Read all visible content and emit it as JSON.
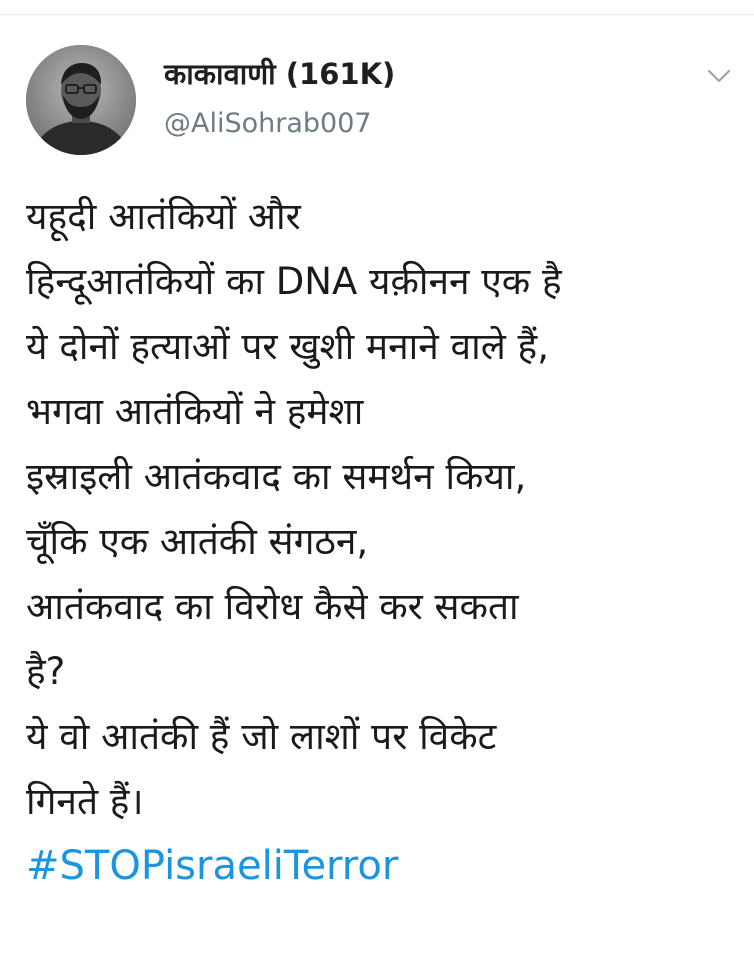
{
  "tweet": {
    "display_name": "काकावाणी (161K)",
    "handle": "@AliSohrab007",
    "avatar_icon": "profile-photo",
    "menu_icon": "chevron-down-icon",
    "lines": [
      "यहूदी आतंकियों और",
      "हिन्दूआतंकियों का DNA यक़ीनन एक है",
      "ये दोनों हत्याओं पर खुशी मनाने वाले हैं,",
      "भगवा आतंकियों ने हमेशा",
      "इस्राइली आतंकवाद का समर्थन किया,",
      "चूँकि एक आतंकी संगठन,",
      "आतंकवाद का विरोध कैसे कर सकता",
      "है?",
      "ये वो आतंकी हैं जो लाशों पर विकेट",
      "गिनते हैं।"
    ],
    "hashtag": "#STOPisraeliTerror"
  },
  "colors": {
    "text": "#1a1a1a",
    "handle": "#6f7b85",
    "hashtag": "#1b95e0",
    "divider": "#e6ecf0"
  }
}
